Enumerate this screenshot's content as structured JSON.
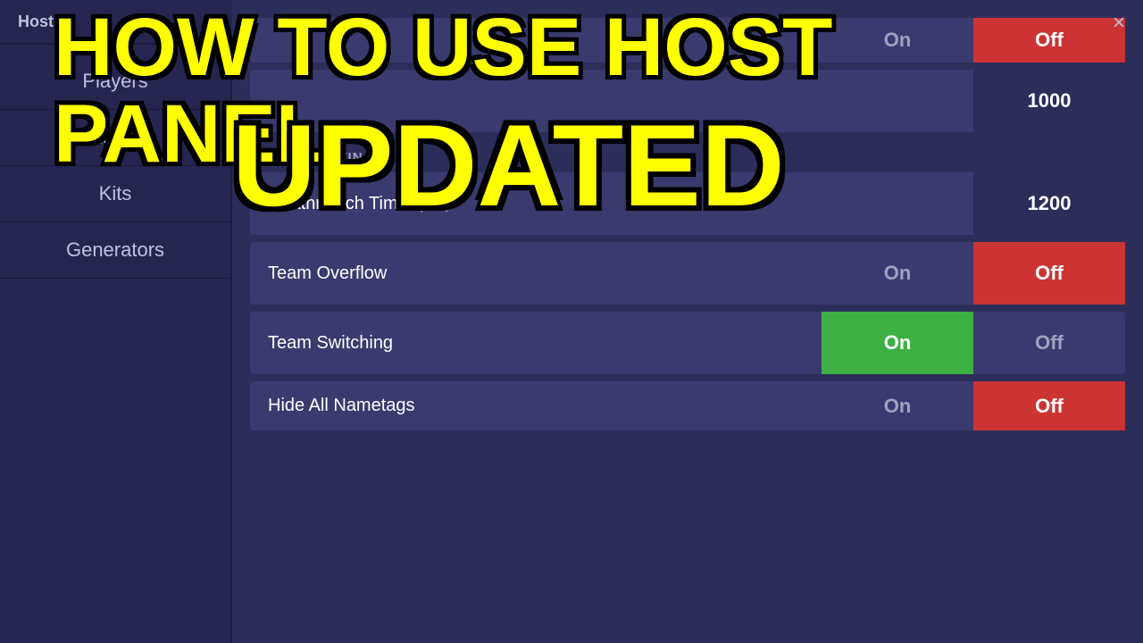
{
  "panel": {
    "title": "Host",
    "close_label": "×"
  },
  "sidebar": {
    "items": [
      {
        "label": "Players",
        "id": "players"
      },
      {
        "label": "Items",
        "id": "items"
      },
      {
        "label": "Kits",
        "id": "kits"
      },
      {
        "label": "Generators",
        "id": "generators"
      }
    ]
  },
  "content": {
    "top_row": {
      "label": "",
      "on_label": "On",
      "off_label": "Off",
      "off_active": true
    },
    "score_row": {
      "value": "1000"
    },
    "match_settings_header": "MATCH SETTINGS",
    "rows": [
      {
        "label": "Deathmatch Time",
        "sub_label": "(sec)",
        "type": "value",
        "value": "1200"
      },
      {
        "label": "Team Overflow",
        "type": "toggle",
        "on_label": "On",
        "off_label": "Off",
        "active": "off"
      },
      {
        "label": "Team Switching",
        "type": "toggle",
        "on_label": "On",
        "off_label": "Off",
        "active": "on"
      },
      {
        "label": "Hide All Nametags",
        "type": "toggle",
        "on_label": "On",
        "off_label": "Off",
        "active": "off"
      }
    ]
  },
  "overlay": {
    "title": "HOW TO USE HOST PANEL",
    "subtitle": "UPDATED"
  }
}
